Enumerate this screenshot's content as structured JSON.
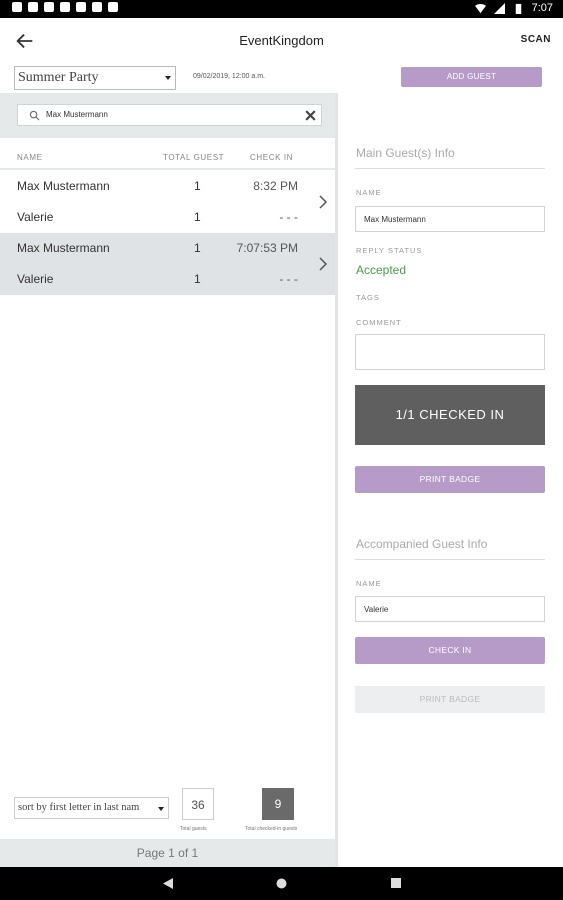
{
  "status_bar": {
    "time": "7:07"
  },
  "app_bar": {
    "title": "EventKingdom",
    "scan_label": "SCAN"
  },
  "event": {
    "selected": "Summer Party",
    "date": "09/02/2019, 12:00 a.m.",
    "add_guest_label": "ADD GUEST"
  },
  "search": {
    "value": "Max Mustermann"
  },
  "table": {
    "headers": {
      "name": "NAME",
      "total": "TOTAL GUEST",
      "checkin": "CHECK IN"
    },
    "groups": [
      {
        "rows": [
          {
            "name": "Max Mustermann",
            "total": "1",
            "checkin": "8:32 PM"
          },
          {
            "name": "Valerie",
            "total": "1",
            "checkin": "- - -"
          }
        ]
      },
      {
        "rows": [
          {
            "name": "Max Mustermann",
            "total": "1",
            "checkin": "7:07:53 PM"
          },
          {
            "name": "Valerie",
            "total": "1",
            "checkin": "- - -"
          }
        ]
      }
    ]
  },
  "footer": {
    "sort_selected": "sort by first letter in last nam",
    "total_guests": "36",
    "total_guests_label": "Total guests",
    "total_checked": "9",
    "total_checked_label": "Total checked-in guests",
    "pager": "Page 1 of 1"
  },
  "detail": {
    "main_title": "Main Guest(s) Info",
    "name_label": "NAME",
    "name_value": "Max Mustermann",
    "reply_label": "REPLY STATUS",
    "reply_value": "Accepted",
    "tags_label": "TAGS",
    "comment_label": "COMMENT",
    "checked_in_text": "1/1 CHECKED IN",
    "print_badge_label": "PRINT BADGE",
    "accompanied_title": "Accompanied Guest Info",
    "acc_name_label": "NAME",
    "acc_name_value": "Valerie",
    "check_in_label": "CHECK IN",
    "acc_print_badge_label": "PRINT BADGE"
  },
  "colors": {
    "accent": "#b69bc8",
    "accepted": "#4c9a4c",
    "checked_block": "#5f5f5f"
  }
}
